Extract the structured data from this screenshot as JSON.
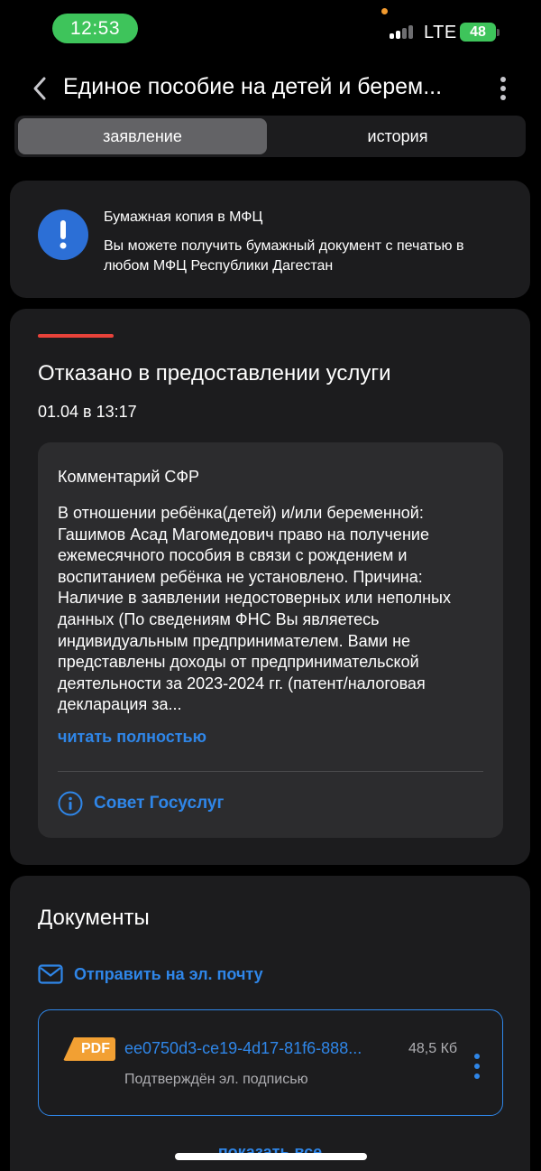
{
  "status_bar": {
    "time": "12:53",
    "network": "LTE",
    "battery": "48"
  },
  "header": {
    "title": "Единое пособие на детей и берем..."
  },
  "tabs": [
    {
      "label": "заявление",
      "active": true
    },
    {
      "label": "история",
      "active": false
    }
  ],
  "mfc_card": {
    "icon": "exclamation-icon",
    "title": "Бумажная копия в МФЦ",
    "text": "Вы можете получить бумажный документ с печатью в любом МФЦ Республики Дагестан"
  },
  "status_card": {
    "title": "Отказано в предоставлении услуги",
    "date": "01.04 в 13:17",
    "comment": {
      "title": "Комментарий СФР",
      "text": "В отношении ребёнка(детей) и/или беременной: Гашимов Асад Магомедович право на получение ежемесячного пособия в связи с рождением и воспитанием ребёнка не установлено. Причина: Наличие в заявлении недостоверных или неполных данных (По сведениям ФНС Вы являетесь индивидуальным предпринимателем. Вами не представлены доходы от предпринимательской деятельности за 2023-2024 гг. (патент/налоговая декларация за...",
      "read_more": "читать полностью",
      "advice": "Совет Госуслуг"
    }
  },
  "documents": {
    "title": "Документы",
    "email_action": "Отправить на эл. почту",
    "file": {
      "badge": "PDF",
      "name": "ee0750d3-ce19-4d17-81f6-888...",
      "size": "48,5 Кб",
      "subtitle": "Подтверждён эл. подписью"
    },
    "show_all": "показать все"
  },
  "colors": {
    "accent": "#2f86e8",
    "danger": "#e8423a",
    "success": "#3ec45b",
    "card": "#1c1c1e",
    "pdf": "#f2a033"
  }
}
